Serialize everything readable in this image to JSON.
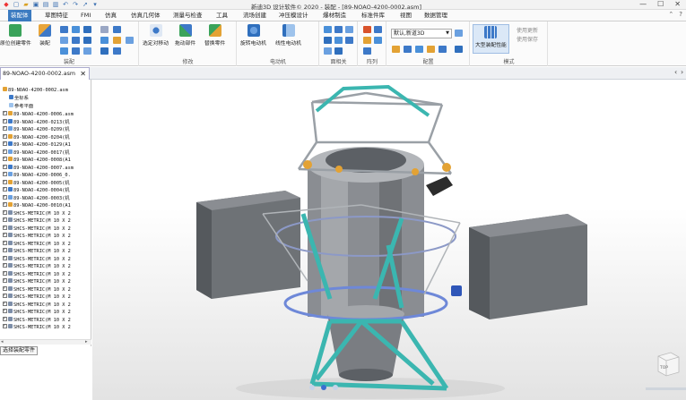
{
  "window": {
    "title": "新迪3D 设计软件© 2020 - 装配 - [89-NOAO-4200-0002.asm]",
    "controls": [
      "—",
      "☐",
      "✕"
    ]
  },
  "menu": {
    "tabs": [
      "装配体",
      "草图特征",
      "FMI",
      "仿真",
      "仿真几何体",
      "测量与检查",
      "工具",
      "流场创建",
      "冲压模设计",
      "爆材制造",
      "标准件库",
      "视图",
      "数据管理"
    ],
    "active": 0
  },
  "ribbon": {
    "groups": [
      {
        "label": "装配",
        "buttons": [
          "原位创建零件",
          "装配"
        ]
      },
      {
        "label": "修改",
        "buttons": [
          "选定对移动",
          "拖动部件",
          "替换零件"
        ]
      },
      {
        "label": "电动机",
        "buttons": [
          "旋转电动机",
          "线性电动机"
        ]
      },
      {
        "label": "面相关",
        "buttons": []
      },
      {
        "label": "阵列",
        "buttons": []
      },
      {
        "label": "配置",
        "buttons": []
      },
      {
        "label": "模式",
        "buttons": [
          "大型装配性能"
        ]
      }
    ],
    "config_combo": "默认,新道3D",
    "mode_options": [
      "使用更新",
      "使用保存"
    ]
  },
  "doc_tab": {
    "name": "89-NOAO-4200-0002.asm",
    "close": "✕"
  },
  "tree": {
    "root": "89-NOAO-4200-0002.asm",
    "sub_items": [
      "坐标系",
      "参考平面"
    ],
    "parts": [
      "89-NOAO-4200-0006.asm",
      "89-NOAO-4200-0213(机",
      "89-NOAO-4200-0209(机",
      "89-NOAO-4200-0204(机",
      "89-NOAO-4200-0129(A1",
      "89-NOAO-4200-0017(机",
      "89-NOAO-4200-0008(A1",
      "89-NOAO-4200-0007.asm",
      "89-NOAO-4200-0006_0.",
      "89-NOAO-4200-0005(机",
      "89-NOAO-4200-0004(机",
      "89-NOAO-4200-0003(机",
      "89-NOAO-4200-0010(A1",
      "SHCS-METRIC(M 10 X 2",
      "SHCS-METRIC(M 10 X 2",
      "SHCS-METRIC(M 10 X 2",
      "SHCS-METRIC(M 10 X 2",
      "SHCS-METRIC(M 10 X 2",
      "SHCS-METRIC(M 10 X 2",
      "SHCS-METRIC(M 10 X 2",
      "SHCS-METRIC(M 10 X 2",
      "SHCS-METRIC(M 10 X 2",
      "SHCS-METRIC(M 10 X 2",
      "SHCS-METRIC(M 10 X 2",
      "SHCS-METRIC(M 10 X 2",
      "SHCS-METRIC(M 10 X 2",
      "SHCS-METRIC(M 10 X 2",
      "SHCS-METRIC(M 10 X 2",
      "SHCS-METRIC(M 10 X 2"
    ],
    "bottom_button": "选择装配零件"
  },
  "viewcube_label": "TOP",
  "colors": {
    "accent": "#3b7ac0",
    "frame_cyan": "#3bb6b0",
    "panel_grey": "#6e7276",
    "body_grey": "#8a8d92",
    "orange": "#e3a234",
    "blue_light": "#6e88d8"
  }
}
